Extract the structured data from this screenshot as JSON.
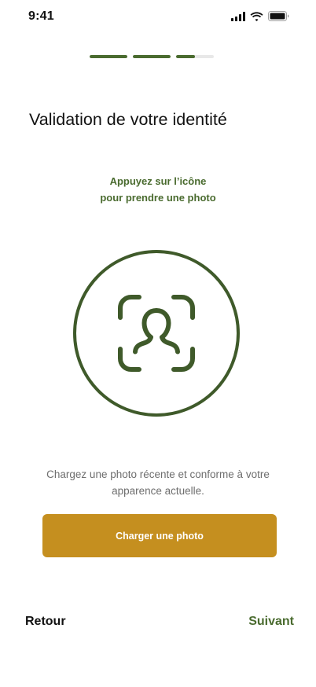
{
  "status_bar": {
    "time": "9:41",
    "icons": [
      "signal-icon",
      "wifi-icon",
      "battery-icon"
    ]
  },
  "progress": {
    "steps": [
      {
        "fill": 1.0
      },
      {
        "fill": 1.0
      },
      {
        "fill": 0.5
      }
    ]
  },
  "page": {
    "title": "Validation de votre identité",
    "instruction_line1": "Appuyez sur l’icône",
    "instruction_line2": "pour prendre une photo",
    "capture_icon": "face-scan-icon",
    "hint_text": "Chargez une photo récente et conforme à votre apparence actuelle."
  },
  "actions": {
    "upload_label": "Charger une photo",
    "back_label": "Retour",
    "next_label": "Suivant"
  },
  "colors": {
    "accent_green": "#4a6b2f",
    "circle_green": "#3f5a2a",
    "button_gold": "#c58f1f",
    "progress_track": "#e8e8e8"
  }
}
